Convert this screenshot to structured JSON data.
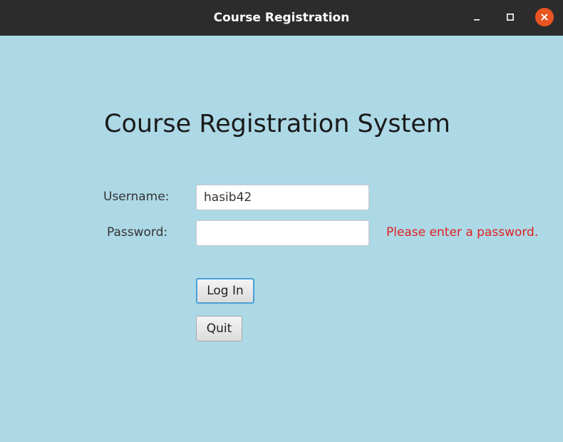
{
  "window": {
    "title": "Course Registration",
    "controls": {
      "minimize_icon": "minimize-icon",
      "maximize_icon": "maximize-icon",
      "close_icon": "close-icon",
      "close_color": "#e95420"
    }
  },
  "main": {
    "heading": "Course Registration System",
    "username_label": "Username:",
    "username_value": "hasib42",
    "password_label": "Password:",
    "password_value": "",
    "password_error": "Please enter a password.",
    "error_color": "#e02020",
    "login_label": "Log In",
    "quit_label": "Quit",
    "background_color": "#add8e6"
  }
}
